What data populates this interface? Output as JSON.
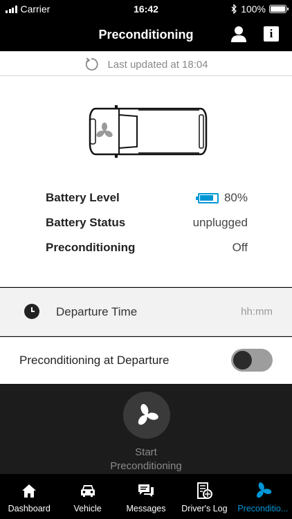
{
  "status_bar": {
    "carrier": "Carrier",
    "time": "16:42",
    "battery_percent": "100%",
    "battery_level": 1.0
  },
  "nav": {
    "title": "Preconditioning",
    "icons": [
      "user-icon",
      "info-icon"
    ],
    "info_glyph": "i"
  },
  "last_updated": "Last updated at 18:04",
  "vehicle_info": {
    "battery_level_label": "Battery Level",
    "battery_level_value": "80%",
    "battery_fill": 0.8,
    "battery_status_label": "Battery Status",
    "battery_status_value": "unplugged",
    "preconditioning_label": "Preconditioning",
    "preconditioning_value": "Off"
  },
  "departure": {
    "label": "Departure Time",
    "placeholder": "hh:mm"
  },
  "departure_toggle": {
    "label": "Preconditioning at Departure",
    "enabled": false
  },
  "action": {
    "line1": "Start",
    "line2": "Preconditioning"
  },
  "tabs": [
    {
      "label": "Dashboard",
      "icon": "house-icon",
      "active": false
    },
    {
      "label": "Vehicle",
      "icon": "car-icon",
      "active": false
    },
    {
      "label": "Messages",
      "icon": "messages-icon",
      "active": false
    },
    {
      "label": "Driver's Log",
      "icon": "log-icon",
      "active": false
    },
    {
      "label": "Preconditio...",
      "icon": "fan-icon",
      "active": true
    }
  ],
  "colors": {
    "accent": "#0096d6",
    "bar": "#000000",
    "panel": "#1c1c1c"
  }
}
